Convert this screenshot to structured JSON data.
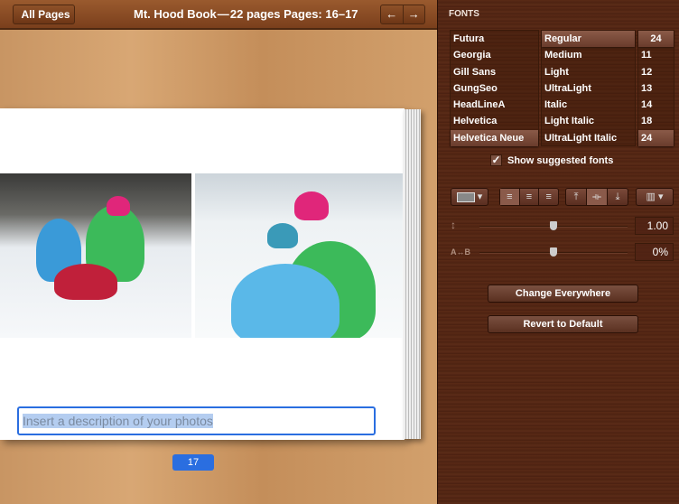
{
  "topbar": {
    "back_label": "All Pages",
    "title": "Mt. Hood Book — 22 pages  Pages: 16–17",
    "prev": "←",
    "next": "→"
  },
  "page": {
    "description_placeholder": "Insert a description of your photos",
    "page_number": "17"
  },
  "fonts": {
    "heading": "FONTS",
    "families": [
      "Futura",
      "Georgia",
      "Gill Sans",
      "GungSeo",
      "HeadLineA",
      "Helvetica",
      "Helvetica Neue"
    ],
    "styles": [
      "Regular",
      "Medium",
      "Light",
      "UltraLight",
      "Italic",
      "Light Italic",
      "UltraLight Italic"
    ],
    "sizes": [
      "24",
      "11",
      "12",
      "13",
      "14",
      "18",
      "24"
    ],
    "selected_family": "Helvetica Neue",
    "selected_style": "Regular",
    "selected_size": "24",
    "show_suggested_label": "Show suggested fonts",
    "show_suggested_checked": true,
    "check": "✓"
  },
  "format": {
    "line_spacing_value": "1.00",
    "line_spacing_fraction": 0.5,
    "char_spacing_label": "A↔B",
    "char_spacing_value": "0%",
    "char_spacing_fraction": 0.5,
    "line_spacing_icon": "↕",
    "change_everywhere": "Change Everywhere",
    "revert": "Revert to Default"
  }
}
